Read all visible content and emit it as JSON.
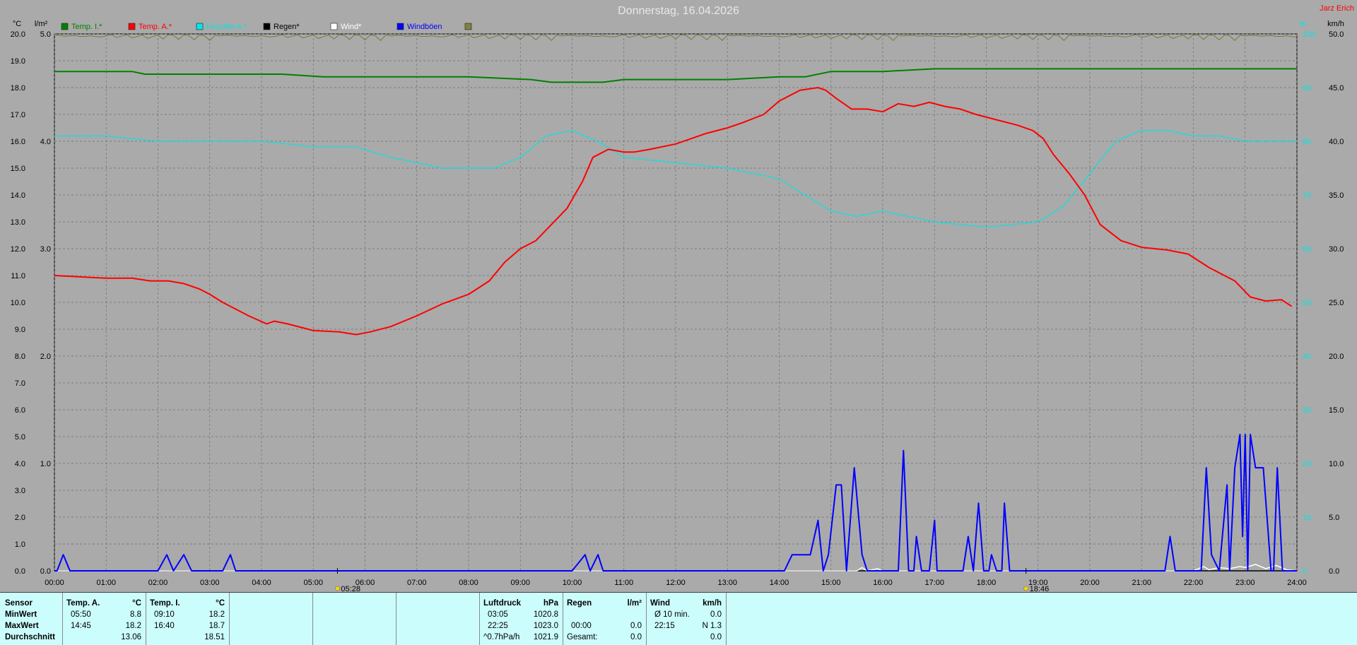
{
  "title": "Donnerstag, 16.04.2026",
  "credit": "Jarz Erich",
  "axes": {
    "left1_unit": "°C",
    "left2_unit": "l/m²",
    "right1_unit": "%",
    "right2_unit": "km/h",
    "left1_ticks": [
      "20.0",
      "19.0",
      "18.0",
      "17.0",
      "16.0",
      "15.0",
      "14.0",
      "13.0",
      "12.0",
      "11.0",
      "10.0",
      "9.0",
      "8.0",
      "7.0",
      "6.0",
      "5.0",
      "4.0",
      "3.0",
      "2.0",
      "1.0",
      "0.0"
    ],
    "left2_ticks": [
      "5.0",
      "4.0",
      "3.0",
      "2.0",
      "1.0",
      "0.0"
    ],
    "right1_ticks": [
      "100",
      "90",
      "80",
      "70",
      "60",
      "50",
      "40",
      "30",
      "20",
      "10",
      "0"
    ],
    "right2_ticks": [
      "50.0",
      "45.0",
      "40.0",
      "35.0",
      "30.0",
      "25.0",
      "20.0",
      "15.0",
      "10.0",
      "5.0",
      "0.0"
    ],
    "x_ticks": [
      "00:00",
      "01:00",
      "02:00",
      "03:00",
      "04:00",
      "05:00",
      "06:00",
      "07:00",
      "08:00",
      "09:00",
      "10:00",
      "11:00",
      "12:00",
      "13:00",
      "14:00",
      "15:00",
      "16:00",
      "17:00",
      "18:00",
      "19:00",
      "20:00",
      "21:00",
      "22:00",
      "23:00",
      "24:00"
    ]
  },
  "sun": {
    "sunrise": "05:28",
    "sunset": "18:46"
  },
  "chart_data": {
    "type": "line",
    "title": "Donnerstag, 16.04.2026",
    "xlim": [
      0,
      24
    ],
    "ylim_temp": [
      0,
      20
    ],
    "ylim_wind": [
      0,
      50
    ],
    "ylim_humidity": [
      0,
      100
    ],
    "grid": true,
    "legend_position": "top",
    "series": [
      {
        "name": "Temp. I.*",
        "color": "#008000",
        "unit": "°C",
        "x": [
          0,
          1.5,
          1.75,
          4.4,
          5.2,
          8,
          9.2,
          9.6,
          10.6,
          11,
          13,
          14,
          14.5,
          15,
          16,
          17,
          24
        ],
        "values": [
          18.6,
          18.6,
          18.5,
          18.5,
          18.4,
          18.4,
          18.3,
          18.2,
          18.2,
          18.3,
          18.3,
          18.4,
          18.4,
          18.6,
          18.6,
          18.7,
          18.7
        ]
      },
      {
        "name": "Temp. A.*",
        "color": "#ff0000",
        "unit": "°C",
        "x": [
          0,
          0.5,
          1,
          1.5,
          1.85,
          2.2,
          2.5,
          2.8,
          3.0,
          3.25,
          3.5,
          3.75,
          4.1,
          4.25,
          4.5,
          5.0,
          5.5,
          5.83,
          6.1,
          6.5,
          7.0,
          7.5,
          8.0,
          8.4,
          8.7,
          9.0,
          9.3,
          9.6,
          9.9,
          10.2,
          10.4,
          10.7,
          11.0,
          11.2,
          11.5,
          12.0,
          12.3,
          12.6,
          13.0,
          13.3,
          13.7,
          14.0,
          14.4,
          14.75,
          14.9,
          15.1,
          15.4,
          15.7,
          16.0,
          16.3,
          16.6,
          16.9,
          17.2,
          17.5,
          17.8,
          18.2,
          18.6,
          18.9,
          19.1,
          19.3,
          19.6,
          19.9,
          20.2,
          20.6,
          21.0,
          21.5,
          21.9,
          22.3,
          22.8,
          23.1,
          23.4,
          23.7,
          23.9
        ],
        "values": [
          11.0,
          10.95,
          10.9,
          10.9,
          10.8,
          10.8,
          10.7,
          10.5,
          10.3,
          10.0,
          9.75,
          9.5,
          9.2,
          9.3,
          9.2,
          8.95,
          8.9,
          8.8,
          8.9,
          9.1,
          9.5,
          9.95,
          10.3,
          10.8,
          11.5,
          12.0,
          12.3,
          12.9,
          13.5,
          14.5,
          15.4,
          15.7,
          15.6,
          15.6,
          15.7,
          15.9,
          16.1,
          16.3,
          16.5,
          16.7,
          17.0,
          17.5,
          17.9,
          18.0,
          17.9,
          17.6,
          17.2,
          17.2,
          17.1,
          17.4,
          17.3,
          17.45,
          17.3,
          17.2,
          17.0,
          16.8,
          16.6,
          16.4,
          16.1,
          15.5,
          14.8,
          14.0,
          12.9,
          12.3,
          12.05,
          11.95,
          11.8,
          11.3,
          10.8,
          10.2,
          10.05,
          10.1,
          9.85
        ]
      },
      {
        "name": "Feuchte A.*",
        "color": "#00e5e5",
        "unit": "%",
        "x": [
          0,
          1.0,
          2.0,
          3.0,
          4.0,
          5.0,
          5.8,
          6.5,
          7.5,
          8.0,
          8.5,
          9.0,
          9.5,
          10.0,
          10.5,
          11.0,
          12.0,
          13.0,
          14.0,
          14.5,
          15.0,
          15.5,
          16.0,
          16.5,
          17.0,
          18.0,
          19.0,
          19.5,
          20.0,
          20.5,
          21.0,
          21.5,
          22.0,
          22.5,
          23.0,
          23.5,
          24
        ],
        "values": [
          81,
          81,
          80,
          80,
          80,
          79,
          79,
          77,
          75,
          75,
          75,
          77,
          81,
          82,
          80,
          77,
          76,
          75,
          73,
          70,
          67,
          66,
          67,
          66,
          65,
          64,
          65,
          68,
          74,
          80,
          82,
          82,
          81,
          81,
          80,
          80,
          80
        ],
        "dashed": true
      },
      {
        "name": "Regen*",
        "color": "#000000",
        "unit": "l/m²",
        "x": [
          0,
          24
        ],
        "values": [
          0,
          0
        ]
      },
      {
        "name": "Wind*",
        "color": "#ffffff",
        "unit": "km/h",
        "x": [
          0,
          15.5,
          15.6,
          15.7,
          15.9,
          16.0,
          22.0,
          22.2,
          22.3,
          22.5,
          22.7,
          22.9,
          23.0,
          23.2,
          23.4,
          23.6,
          23.8,
          24
        ],
        "values": [
          0,
          0,
          0.3,
          0,
          0.2,
          0,
          0,
          0.4,
          0.1,
          0.3,
          0.2,
          0.4,
          0.3,
          0.6,
          0.2,
          0.5,
          0.1,
          0
        ]
      },
      {
        "name": "Windböen",
        "color": "#0000ff",
        "unit": "km/h",
        "x": [
          0,
          0.05,
          0.17,
          0.3,
          2.0,
          2.17,
          2.3,
          2.5,
          2.65,
          2.75,
          3.25,
          3.4,
          3.5,
          10.0,
          10.25,
          10.35,
          10.5,
          10.6,
          10.8,
          14.1,
          14.25,
          14.4,
          14.6,
          14.75,
          14.85,
          14.95,
          15.1,
          15.2,
          15.3,
          15.45,
          15.6,
          15.7,
          16.3,
          16.4,
          16.5,
          16.6,
          16.65,
          16.75,
          16.9,
          17.0,
          17.05,
          17.15,
          17.3,
          17.55,
          17.65,
          17.75,
          17.85,
          17.95,
          18.05,
          18.1,
          18.2,
          18.3,
          18.35,
          18.45,
          18.6,
          21.45,
          21.55,
          21.65,
          22.15,
          22.25,
          22.35,
          22.5,
          22.65,
          22.7,
          22.8,
          22.9,
          22.95,
          23.0,
          23.05,
          23.1,
          23.2,
          23.3,
          23.35,
          23.5,
          23.55,
          23.62,
          23.72,
          24
        ],
        "values": [
          0,
          0,
          1.5,
          0,
          0,
          1.5,
          0,
          1.5,
          0,
          0,
          0,
          1.5,
          0,
          0,
          1.5,
          0,
          1.5,
          0,
          0,
          0,
          1.5,
          1.5,
          1.5,
          4.7,
          0,
          1.5,
          8.0,
          8.0,
          0,
          9.6,
          1.5,
          0,
          0,
          11.2,
          0,
          0,
          3.2,
          0,
          0,
          4.7,
          0,
          0,
          0,
          0,
          3.2,
          0,
          6.3,
          0,
          0,
          1.5,
          0,
          0,
          6.3,
          0,
          0,
          0,
          3.2,
          0,
          0,
          9.6,
          1.5,
          0,
          8.0,
          0,
          9.6,
          12.7,
          3.2,
          12.7,
          0,
          12.7,
          9.6,
          9.6,
          9.6,
          0,
          0,
          9.6,
          0,
          0
        ]
      }
    ]
  },
  "stats": {
    "headers": {
      "sensor": "Sensor",
      "temp_a": "Temp. A.",
      "temp_a_unit": "°C",
      "temp_i": "Temp. I.",
      "temp_i_unit": "°C",
      "pressure": "Luftdruck",
      "pressure_unit": "hPa",
      "rain": "Regen",
      "rain_unit": "l/m²",
      "wind": "Wind",
      "wind_unit": "km/h"
    },
    "row_labels": {
      "min": "MinWert",
      "max": "MaxWert",
      "avg": "Durchschnitt"
    },
    "temp_a": {
      "min_time": "05:50",
      "min_val": "8.8",
      "max_time": "14:45",
      "max_val": "18.2",
      "avg_val": "13.06"
    },
    "temp_i": {
      "min_time": "09:10",
      "min_val": "18.2",
      "max_time": "16:40",
      "max_val": "18.7",
      "avg_val": "18.51"
    },
    "pressure": {
      "min_time": "03:05",
      "min_val": "1020.8",
      "max_time": "22:25",
      "max_val": "1023.0",
      "trend_label": "^0.7hPa/h",
      "avg_val": "1021.9"
    },
    "rain": {
      "time": "00:00",
      "val": "0.0",
      "total_label": "Gesamt:",
      "total_val": "0.0"
    },
    "wind": {
      "avg_label": "Ø 10 min.",
      "avg_val": "0.0",
      "max_time": "22:15",
      "max_val": "N 1.3",
      "total_val": "0.0"
    }
  }
}
